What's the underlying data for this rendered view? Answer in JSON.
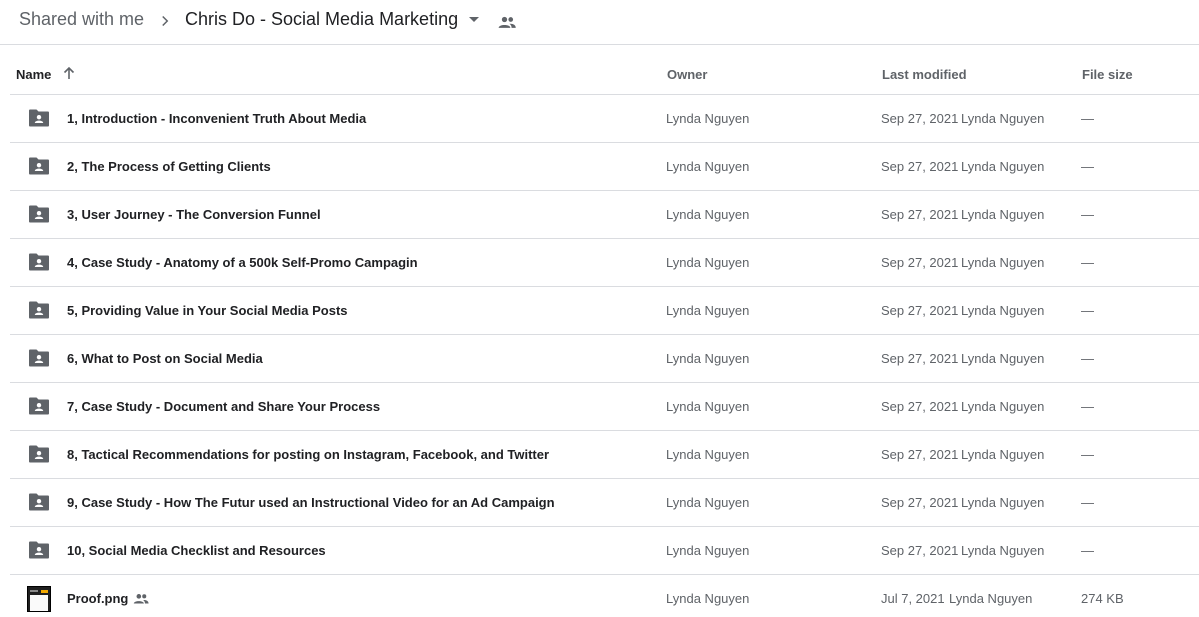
{
  "breadcrumb": {
    "root": "Shared with me",
    "current": "Chris Do - Social Media Marketing"
  },
  "columns": {
    "name": "Name",
    "owner": "Owner",
    "last_modified": "Last modified",
    "file_size": "File size"
  },
  "rows": [
    {
      "name": "1, Introduction - Inconvenient Truth About Media",
      "owner": "Lynda Nguyen",
      "modified_date": "Sep 27, 2021",
      "modified_by": "Lynda Nguyen",
      "size": "—",
      "icon": "shared-folder-icon"
    },
    {
      "name": "2, The Process of Getting Clients",
      "owner": "Lynda Nguyen",
      "modified_date": "Sep 27, 2021",
      "modified_by": "Lynda Nguyen",
      "size": "—",
      "icon": "shared-folder-icon"
    },
    {
      "name": "3, User Journey - The Conversion Funnel",
      "owner": "Lynda Nguyen",
      "modified_date": "Sep 27, 2021",
      "modified_by": "Lynda Nguyen",
      "size": "—",
      "icon": "shared-folder-icon"
    },
    {
      "name": "4, Case Study - Anatomy of a 500k Self-Promo Campagin",
      "owner": "Lynda Nguyen",
      "modified_date": "Sep 27, 2021",
      "modified_by": "Lynda Nguyen",
      "size": "—",
      "icon": "shared-folder-icon"
    },
    {
      "name": "5, Providing Value in Your Social Media Posts",
      "owner": "Lynda Nguyen",
      "modified_date": "Sep 27, 2021",
      "modified_by": "Lynda Nguyen",
      "size": "—",
      "icon": "shared-folder-icon"
    },
    {
      "name": "6, What to Post on Social Media",
      "owner": "Lynda Nguyen",
      "modified_date": "Sep 27, 2021",
      "modified_by": "Lynda Nguyen",
      "size": "—",
      "icon": "shared-folder-icon"
    },
    {
      "name": "7, Case Study - Document and Share Your Process",
      "owner": "Lynda Nguyen",
      "modified_date": "Sep 27, 2021",
      "modified_by": "Lynda Nguyen",
      "size": "—",
      "icon": "shared-folder-icon"
    },
    {
      "name": "8, Tactical Recommendations for posting on Instagram, Facebook, and Twitter",
      "owner": "Lynda Nguyen",
      "modified_date": "Sep 27, 2021",
      "modified_by": "Lynda Nguyen",
      "size": "—",
      "icon": "shared-folder-icon"
    },
    {
      "name": "9, Case Study - How The Futur used an Instructional Video for an Ad Campaign",
      "owner": "Lynda Nguyen",
      "modified_date": "Sep 27, 2021",
      "modified_by": "Lynda Nguyen",
      "size": "—",
      "icon": "shared-folder-icon"
    },
    {
      "name": "10, Social Media Checklist and Resources",
      "owner": "Lynda Nguyen",
      "modified_date": "Sep 27, 2021",
      "modified_by": "Lynda Nguyen",
      "size": "—",
      "icon": "shared-folder-icon"
    },
    {
      "name": "Proof.png",
      "owner": "Lynda Nguyen",
      "modified_date": "Jul 7, 2021",
      "modified_by": "Lynda Nguyen",
      "size": "274 KB",
      "icon": "image-thumbnail",
      "shared": true
    }
  ],
  "colors": {
    "text_primary": "#202124",
    "text_secondary": "#5f6368",
    "divider": "#dadce0",
    "folder_icon": "#5f6368"
  }
}
